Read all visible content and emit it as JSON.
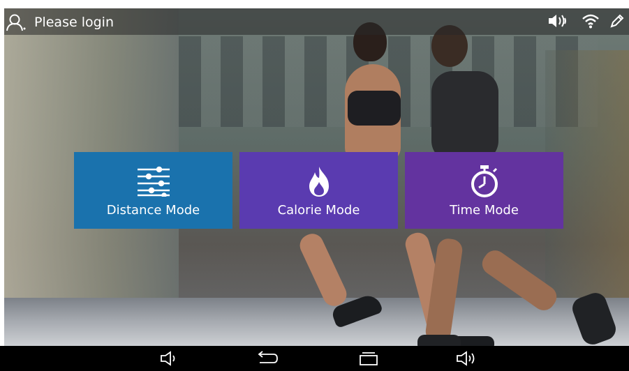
{
  "status_bar": {
    "login_text": "Please login",
    "icons": [
      "user-icon",
      "volume-icon",
      "wifi-icon",
      "pen-icon"
    ]
  },
  "modes": [
    {
      "label": "Distance Mode",
      "icon": "sliders-icon",
      "color": "#1a72ad"
    },
    {
      "label": "Calorie Mode",
      "icon": "flame-icon",
      "color": "#5a3bb0"
    },
    {
      "label": "Time Mode",
      "icon": "stopwatch-icon",
      "color": "#63339f"
    }
  ],
  "nav_bar": {
    "buttons": [
      "volume-down-icon",
      "back-icon",
      "recent-apps-icon",
      "volume-up-icon"
    ]
  }
}
